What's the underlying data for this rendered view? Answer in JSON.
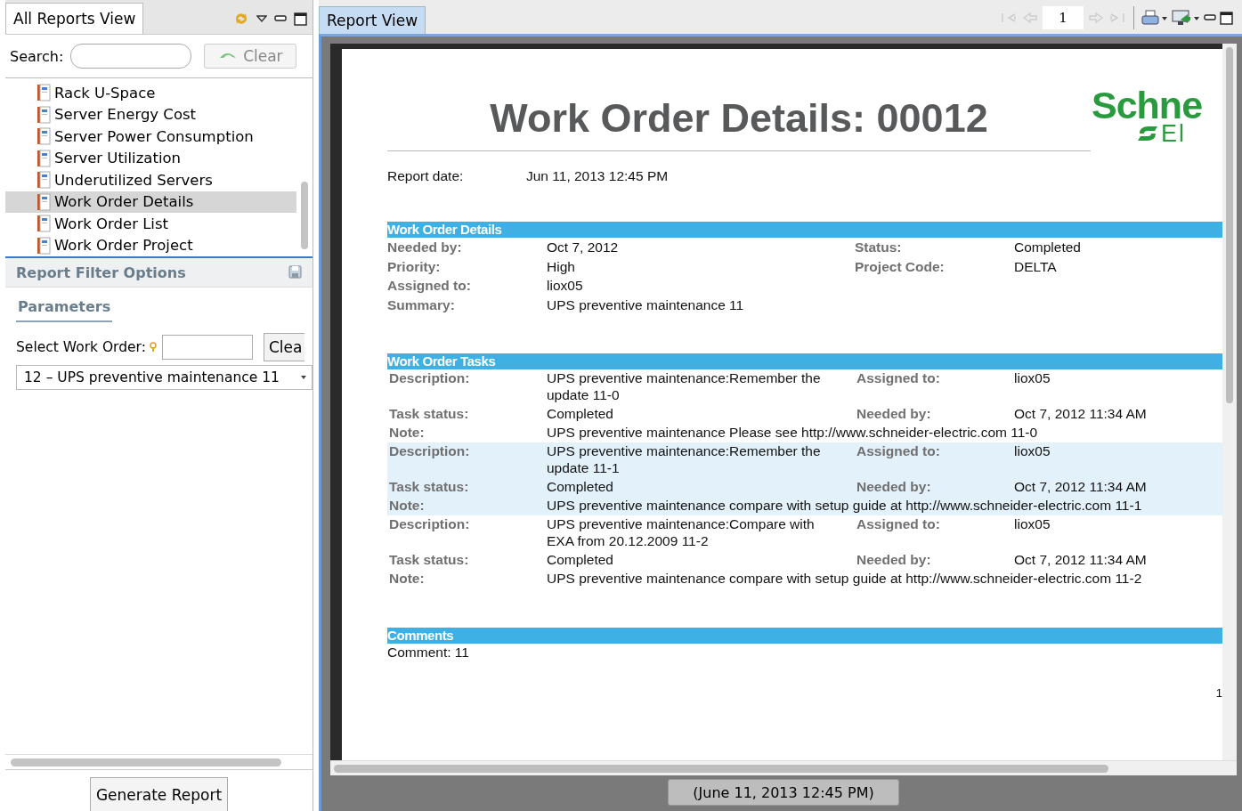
{
  "reports_view": {
    "title": "All Reports View",
    "search": {
      "label": "Search:"
    },
    "clear_button": "Clear",
    "reports": [
      {
        "label": "Rack U-Space",
        "selected": false
      },
      {
        "label": "Server Energy Cost",
        "selected": false
      },
      {
        "label": "Server Power Consumption",
        "selected": false
      },
      {
        "label": "Server Utilization",
        "selected": false
      },
      {
        "label": "Underutilized Servers",
        "selected": false
      },
      {
        "label": "Work Order Details",
        "selected": true
      },
      {
        "label": "Work Order List",
        "selected": false
      },
      {
        "label": "Work Order Project",
        "selected": false
      }
    ],
    "filter_options": {
      "title": "Report Filter Options",
      "tab": "Parameters",
      "select_label": "Select Work Order:",
      "clear_button": "Clea",
      "work_order": "12 – UPS preventive maintenance 11"
    },
    "generate_button": "Generate Report"
  },
  "report_view": {
    "tab": "Report View",
    "page": "1",
    "document": {
      "title": "Work Order Details: 00012",
      "logo": {
        "line_1": "Schne",
        "line_2": "El"
      },
      "report_date": {
        "label": "Report date:",
        "value": "Jun 11, 2013 12:45 PM"
      },
      "details": {
        "heading": "Work Order Details",
        "rows": [
          {
            "label": "Needed by:",
            "value": "Oct 7, 2012",
            "label_2": "Status:",
            "value_2": "Completed"
          },
          {
            "label": "Priority:",
            "value": "High",
            "label_2": "Project Code:",
            "value_2": "DELTA"
          },
          {
            "label": "Assigned to:",
            "value": "liox05"
          },
          {
            "label": "Summary:",
            "value": "UPS preventive maintenance 11"
          }
        ]
      },
      "tasks": {
        "heading": "Work Order Tasks",
        "items": [
          {
            "shaded": false,
            "rows": [
              {
                "label": "Description:",
                "value": "UPS preventive maintenance:Remember the update 11-0",
                "label_2": "Assigned to:",
                "value_2": "liox05"
              },
              {
                "label": "Task status:",
                "value": "Completed",
                "label_2": "Needed by:",
                "value_2": "Oct 7, 2012 11:34 AM"
              },
              {
                "label": "Note:",
                "value": "UPS preventive maintenance Please see http://www.schneider-electric.com 11-0"
              }
            ]
          },
          {
            "shaded": true,
            "rows": [
              {
                "label": "Description:",
                "value": "UPS preventive maintenance:Remember the update 11-1",
                "label_2": "Assigned to:",
                "value_2": "liox05"
              },
              {
                "label": "Task status:",
                "value": "Completed",
                "label_2": "Needed by:",
                "value_2": "Oct 7, 2012 11:34 AM"
              },
              {
                "label": "Note:",
                "value": "UPS preventive maintenance compare with setup guide at http://www.schneider-electric.com 11-1"
              }
            ]
          },
          {
            "shaded": false,
            "rows": [
              {
                "label": "Description:",
                "value": "UPS preventive maintenance:Compare with EXA from 20.12.2009 11-2",
                "label_2": "Assigned to:",
                "value_2": "liox05"
              },
              {
                "label": "Task status:",
                "value": "Completed",
                "label_2": "Needed by:",
                "value_2": "Oct 7, 2012 11:34 AM"
              },
              {
                "label": "Note:",
                "value": "UPS preventive maintenance compare with setup guide at http://www.schneider-electric.com 11-2"
              }
            ]
          }
        ]
      },
      "comments": {
        "heading": "Comments",
        "text": "Comment: 11"
      },
      "page_number": "1"
    },
    "status": "(June 11, 2013 12:45 PM)"
  }
}
